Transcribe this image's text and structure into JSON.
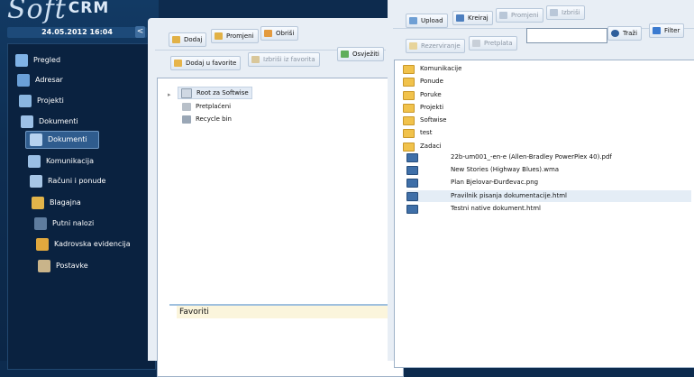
{
  "app": {
    "logo_main": "Soft",
    "logo_suffix": "CRM",
    "datetime": "24.05.2012 16:04",
    "collapse": "<"
  },
  "nav": [
    {
      "label": "Pregled",
      "icon": "overview-icon",
      "color": "#7fb2e6"
    },
    {
      "label": "Adresar",
      "icon": "address-book-icon",
      "color": "#6aa0d8"
    },
    {
      "label": "Projekti",
      "icon": "projects-icon",
      "color": "#8ab6e0"
    },
    {
      "label": "Dokumenti",
      "icon": "documents-icon",
      "color": "#9cc0e6"
    },
    {
      "label": "Dokumenti",
      "icon": "document-icon",
      "color": "#b7d2ef",
      "active": true
    },
    {
      "label": "Komunikacija",
      "icon": "communication-icon",
      "color": "#9bbfe4"
    },
    {
      "label": "Računi i ponude",
      "icon": "invoices-icon",
      "color": "#a7c6e6"
    },
    {
      "label": "Blagajna",
      "icon": "cash-register-icon",
      "color": "#e2b44a"
    },
    {
      "label": "Putni nalozi",
      "icon": "travel-orders-icon",
      "color": "#5e7c9e"
    },
    {
      "label": "Kadrovska evidencija",
      "icon": "hr-records-icon",
      "color": "#e0a83e"
    },
    {
      "label": "Postavke",
      "icon": "settings-icon",
      "color": "#c9b48a"
    }
  ],
  "left_toolbar": {
    "add": "Dodaj",
    "change": "Promjeni",
    "delete": "Obriši",
    "add_favorite": "Dodaj u favorite",
    "remove_favorite": "Izbriši iz favorita",
    "refresh": "Osvježiti"
  },
  "tree": {
    "root": "Root za Softwise",
    "prepaid": "Pretplaćeni",
    "recycle": "Recycle bin"
  },
  "favorites": {
    "title": "Favoriti"
  },
  "right_toolbar": {
    "upload": "Upload",
    "create": "Kreiraj",
    "change": "Promjeni",
    "delete": "Izbriši",
    "reserve": "Rezerviranje",
    "subscribe": "Pretplata",
    "search_value": "",
    "search": "Traži",
    "filter": "Filter"
  },
  "files": [
    {
      "name": "Komunikacije",
      "type": "folder"
    },
    {
      "name": "Ponude",
      "type": "folder"
    },
    {
      "name": "Poruke",
      "type": "folder"
    },
    {
      "name": "Projekti",
      "type": "folder"
    },
    {
      "name": "Softwise",
      "type": "folder"
    },
    {
      "name": "test",
      "type": "folder"
    },
    {
      "name": "Zadaci",
      "type": "folder"
    },
    {
      "name": "22b-um001_-en-e (Allen-Bradley PowerPlex 40).pdf",
      "type": "doc"
    },
    {
      "name": "New Stories (Highway Blues).wma",
      "type": "doc"
    },
    {
      "name": "Plan Bjelovar-Đurđevac.png",
      "type": "doc"
    },
    {
      "name": "Pravilnik pisanja dokumentacije.html",
      "type": "doc",
      "selected": true
    },
    {
      "name": "Testni native dokument.html",
      "type": "doc"
    }
  ]
}
